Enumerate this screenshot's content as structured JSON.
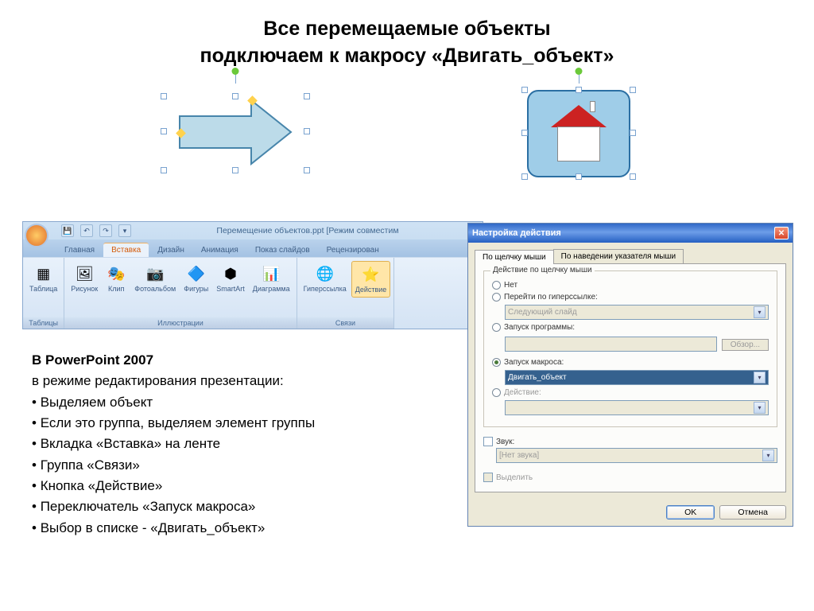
{
  "title_line1": "Все перемещаемые объекты",
  "title_line2": "подключаем к макросу «Двигать_объект»",
  "ribbon": {
    "window_title": "Перемещение объектов.ppt [Режим совместим",
    "tabs": [
      "Главная",
      "Вставка",
      "Дизайн",
      "Анимация",
      "Показ слайдов",
      "Рецензирован"
    ],
    "active_tab": "Вставка",
    "groups": {
      "g1": {
        "label": "Таблицы",
        "items": [
          {
            "name": "table",
            "label": "Таблица"
          }
        ]
      },
      "g2": {
        "label": "Иллюстрации",
        "items": [
          {
            "name": "picture",
            "label": "Рисунок"
          },
          {
            "name": "clip",
            "label": "Клип"
          },
          {
            "name": "album",
            "label": "Фотоальбом"
          },
          {
            "name": "shapes",
            "label": "Фигуры"
          },
          {
            "name": "smartart",
            "label": "SmartArt"
          },
          {
            "name": "chart",
            "label": "Диаграмма"
          }
        ]
      },
      "g3": {
        "label": "Связи",
        "items": [
          {
            "name": "hyperlink",
            "label": "Гиперссылка"
          },
          {
            "name": "action",
            "label": "Действие"
          }
        ]
      }
    }
  },
  "instructions": {
    "header": "В PowerPoint 2007",
    "sub": "в режиме редактирования презентации:",
    "items": [
      "Выделяем объект",
      "Если это группа, выделяем элемент группы",
      "Вкладка «Вставка» на ленте",
      "Группа «Связи»",
      "Кнопка «Действие»",
      "Переключатель «Запуск макроса»",
      "Выбор в списке - «Двигать_объект»"
    ]
  },
  "dialog": {
    "title": "Настройка действия",
    "tabs": [
      "По щелчку мыши",
      "По наведении указателя мыши"
    ],
    "fieldset": "Действие по щелчку мыши",
    "opt_none": "Нет",
    "opt_hyperlink": "Перейти по гиперссылке:",
    "hyperlink_value": "Следующий слайд",
    "opt_program": "Запуск программы:",
    "browse": "Обзор...",
    "opt_macro": "Запуск макроса:",
    "macro_value": "Двигать_объект",
    "opt_action": "Действие:",
    "sound_label": "Звук:",
    "sound_value": "[Нет звука]",
    "highlight": "Выделить",
    "ok": "OK",
    "cancel": "Отмена"
  }
}
